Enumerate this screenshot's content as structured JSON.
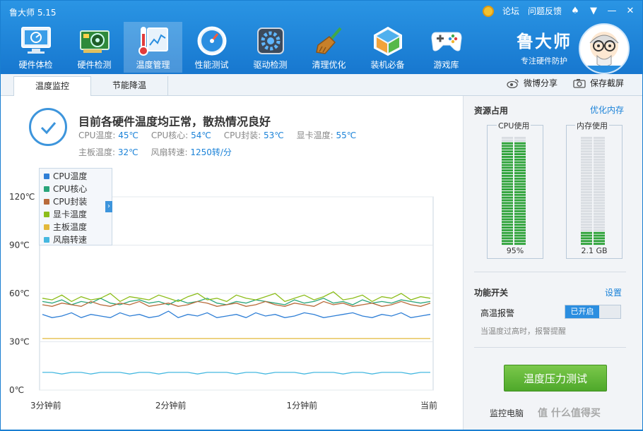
{
  "app": {
    "title": "鲁大师 5.15"
  },
  "topbar": {
    "forum": "论坛",
    "feedback": "问题反馈"
  },
  "nav": [
    {
      "label": "硬件体检",
      "icon": "monitor-icon"
    },
    {
      "label": "硬件检测",
      "icon": "graphics-card-icon"
    },
    {
      "label": "温度管理",
      "icon": "thermometer-icon",
      "active": true
    },
    {
      "label": "性能测试",
      "icon": "speedometer-icon"
    },
    {
      "label": "驱动检测",
      "icon": "driver-gear-icon"
    },
    {
      "label": "清理优化",
      "icon": "broom-icon"
    },
    {
      "label": "装机必备",
      "icon": "install-box-icon"
    },
    {
      "label": "游戏库",
      "icon": "gamepad-icon"
    }
  ],
  "brand": {
    "name": "鲁大师",
    "slogan": "专注硬件防护"
  },
  "tabs": [
    {
      "label": "温度监控",
      "active": true
    },
    {
      "label": "节能降温"
    }
  ],
  "share": {
    "weibo": "微博分享",
    "screenshot": "保存截屏"
  },
  "status": {
    "title": "目前各硬件温度均正常，散热情况良好",
    "cpu_temp_label": "CPU温度:",
    "cpu_temp": "45℃",
    "cpu_core_label": "CPU核心:",
    "cpu_core": "54℃",
    "cpu_pkg_label": "CPU封装:",
    "cpu_pkg": "53℃",
    "gpu_temp_label": "显卡温度:",
    "gpu_temp": "55℃",
    "board_temp_label": "主板温度:",
    "board_temp": "32℃",
    "fan_label": "风扇转速:",
    "fan": "1250转/分"
  },
  "chart_data": {
    "type": "line",
    "yticks": [
      "120℃",
      "90℃",
      "60℃",
      "30℃",
      "0℃"
    ],
    "ylim": [
      0,
      120
    ],
    "xticks": [
      "3分钟前",
      "2分钟前",
      "1分钟前",
      "当前"
    ],
    "grid": true,
    "legend": "top-left",
    "series": [
      {
        "name": "CPU温度",
        "color": "#2f7fd6",
        "values": [
          47,
          45,
          46,
          48,
          45,
          47,
          46,
          45,
          48,
          46,
          47,
          45,
          46,
          49,
          45,
          47,
          46,
          48,
          45,
          46,
          47,
          45,
          48,
          46,
          47,
          45,
          46,
          48,
          47,
          45,
          46,
          47,
          48,
          46,
          45,
          47,
          46,
          48,
          45,
          46,
          47
        ]
      },
      {
        "name": "CPU核心",
        "color": "#2aa57a",
        "values": [
          55,
          54,
          56,
          53,
          55,
          54,
          57,
          54,
          53,
          55,
          56,
          54,
          55,
          53,
          56,
          54,
          55,
          57,
          54,
          53,
          55,
          54,
          56,
          55,
          54,
          53,
          56,
          54,
          55,
          57,
          54,
          55,
          53,
          56,
          54,
          55,
          54,
          56,
          55,
          54,
          55
        ]
      },
      {
        "name": "CPU封装",
        "color": "#b86a3a",
        "values": [
          53,
          52,
          54,
          53,
          52,
          55,
          53,
          52,
          54,
          53,
          55,
          52,
          53,
          54,
          52,
          53,
          55,
          54,
          52,
          53,
          54,
          52,
          53,
          55,
          53,
          52,
          54,
          53,
          52,
          55,
          53,
          54,
          52,
          53,
          54,
          52,
          53,
          55,
          53,
          52,
          54
        ]
      },
      {
        "name": "显卡温度",
        "color": "#8cbd1a",
        "values": [
          57,
          56,
          59,
          55,
          58,
          56,
          57,
          60,
          55,
          58,
          57,
          56,
          59,
          57,
          55,
          58,
          60,
          56,
          57,
          55,
          59,
          57,
          56,
          58,
          60,
          55,
          57,
          59,
          56,
          58,
          61,
          56,
          57,
          59,
          55,
          58,
          57,
          60,
          56,
          58,
          57
        ]
      },
      {
        "name": "主板温度",
        "color": "#e3b83a",
        "values": [
          32,
          32,
          32,
          32,
          32,
          32,
          32,
          32,
          32,
          32,
          32,
          32,
          32,
          32,
          32,
          32,
          32,
          32,
          32,
          32,
          32,
          32,
          32,
          32,
          32,
          32,
          32,
          32,
          32,
          32,
          32,
          32,
          32,
          32,
          32,
          32,
          32,
          32,
          32,
          32,
          32
        ]
      },
      {
        "name": "风扇转速",
        "color": "#45b8e0",
        "values": [
          11,
          11,
          10,
          11,
          11,
          10,
          11,
          11,
          11,
          10,
          11,
          11,
          10,
          11,
          11,
          11,
          10,
          11,
          11,
          11,
          10,
          11,
          11,
          10,
          11,
          11,
          11,
          10,
          11,
          11,
          11,
          10,
          11,
          11,
          10,
          11,
          11,
          11,
          10,
          11,
          11
        ]
      }
    ]
  },
  "resources": {
    "title": "资源占用",
    "optimize": "优化内存",
    "cpu_label": "CPU使用",
    "cpu_value": "95%",
    "cpu_fraction": 0.95,
    "mem_label": "内存使用",
    "mem_value": "2.1 GB",
    "mem_fraction": 0.13
  },
  "functions": {
    "title": "功能开关",
    "settings": "设置",
    "alarm_label": "高温报警",
    "alarm_state": "已开启",
    "alarm_desc": "当温度过高时，报警提醒"
  },
  "stress_button": "温度压力测试",
  "footer": {
    "monitor": "监控电脑"
  },
  "watermark": "值 什么值得买",
  "colors": {
    "accent": "#1a82d8",
    "header": "#1f86d8",
    "bar_green": "#2fa33a"
  }
}
